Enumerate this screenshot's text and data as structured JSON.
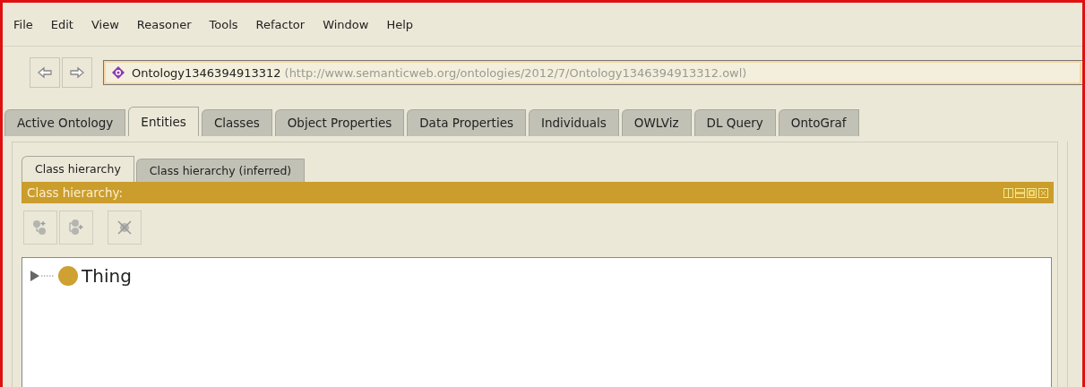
{
  "menu": [
    "File",
    "Edit",
    "View",
    "Reasoner",
    "Tools",
    "Refactor",
    "Window",
    "Help"
  ],
  "nav": {
    "back_disabled": false,
    "forward_disabled": false
  },
  "address": {
    "name": "Ontology1346394913312",
    "iri": "(http://www.semanticweb.org/ontologies/2012/7/Ontology1346394913312.owl)"
  },
  "tabs": [
    {
      "label": "Active Ontology",
      "selected": false
    },
    {
      "label": "Entities",
      "selected": true
    },
    {
      "label": "Classes",
      "selected": false
    },
    {
      "label": "Object Properties",
      "selected": false
    },
    {
      "label": "Data Properties",
      "selected": false
    },
    {
      "label": "Individuals",
      "selected": false
    },
    {
      "label": "OWLViz",
      "selected": false
    },
    {
      "label": "DL Query",
      "selected": false
    },
    {
      "label": "OntoGraf",
      "selected": false
    }
  ],
  "subtabs": [
    {
      "label": "Class hierarchy",
      "selected": true
    },
    {
      "label": "Class hierarchy (inferred)",
      "selected": false
    }
  ],
  "view": {
    "title": "Class hierarchy:",
    "toolbar": [
      {
        "kind": "add-subclass",
        "disabled": true
      },
      {
        "kind": "add-sibling",
        "disabled": true
      },
      {
        "kind": "delete",
        "disabled": true
      }
    ],
    "tree": [
      {
        "label": "Thing",
        "expanded": false
      }
    ]
  }
}
